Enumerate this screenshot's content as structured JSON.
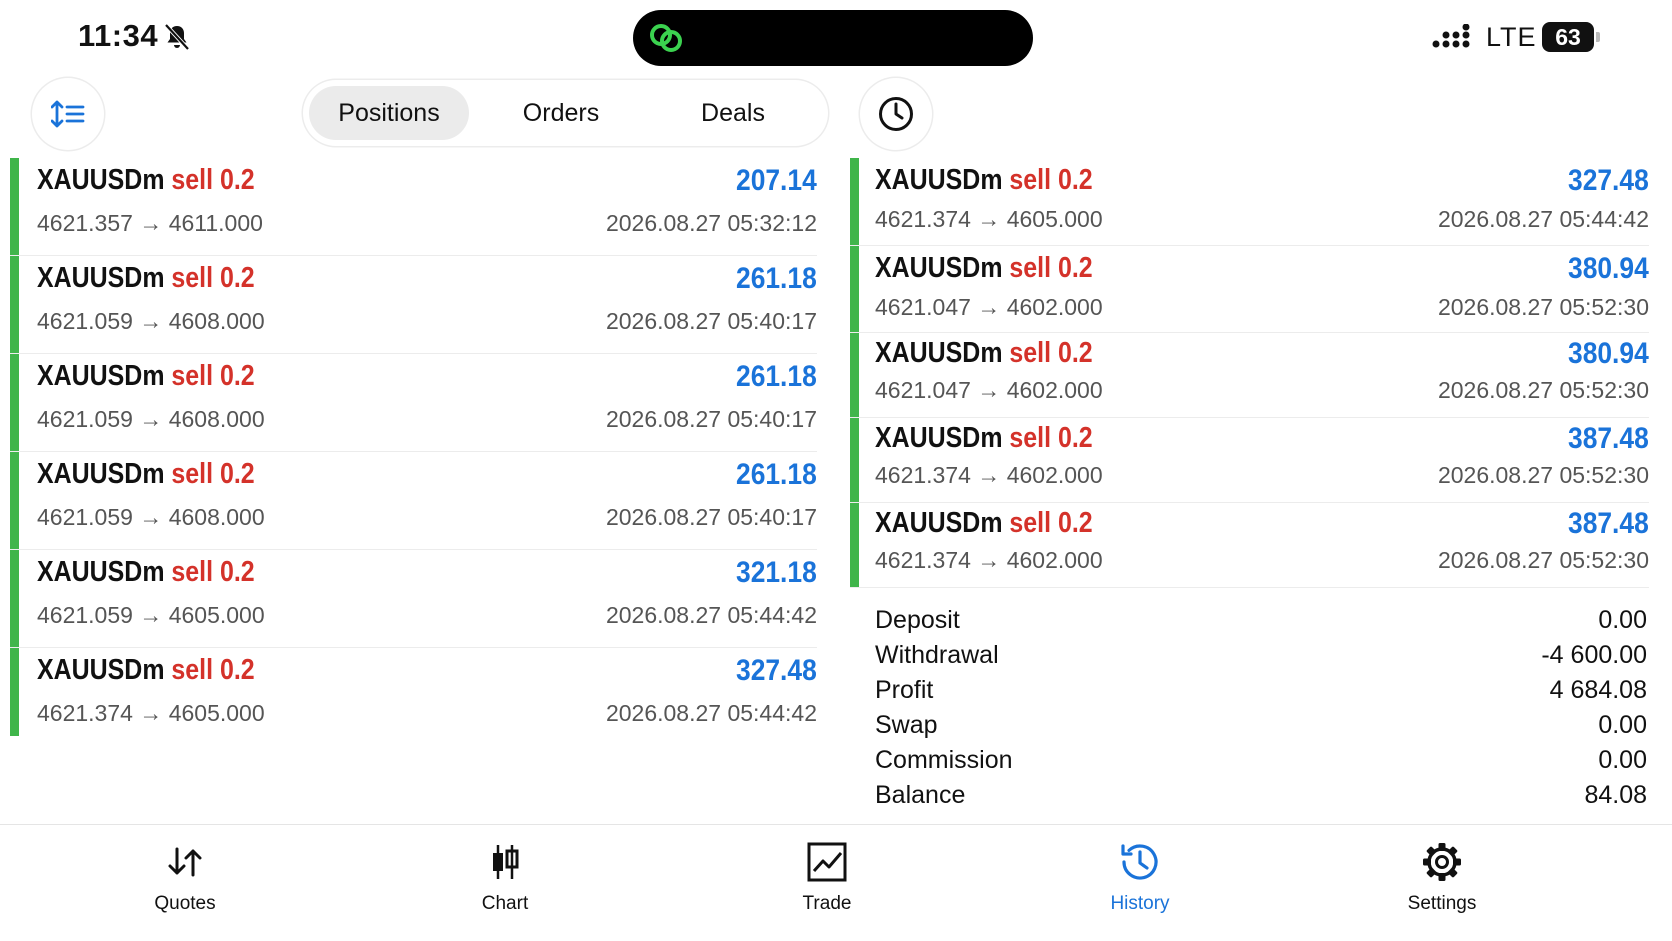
{
  "status_bar": {
    "time": "11:34",
    "network": "LTE",
    "battery": "63"
  },
  "toolbar": {
    "tabs": [
      {
        "label": "Positions",
        "active": true
      },
      {
        "label": "Orders",
        "active": false
      },
      {
        "label": "Deals",
        "active": false
      }
    ]
  },
  "deals_left": [
    {
      "symbol": "XAUUSDm",
      "side": "sell 0.2",
      "prices": "4621.357 → 4611.000",
      "profit": "207.14",
      "time": "2026.08.27 05:32:12"
    },
    {
      "symbol": "XAUUSDm",
      "side": "sell 0.2",
      "prices": "4621.059 → 4608.000",
      "profit": "261.18",
      "time": "2026.08.27 05:40:17"
    },
    {
      "symbol": "XAUUSDm",
      "side": "sell 0.2",
      "prices": "4621.059 → 4608.000",
      "profit": "261.18",
      "time": "2026.08.27 05:40:17"
    },
    {
      "symbol": "XAUUSDm",
      "side": "sell 0.2",
      "prices": "4621.059 → 4608.000",
      "profit": "261.18",
      "time": "2026.08.27 05:40:17"
    },
    {
      "symbol": "XAUUSDm",
      "side": "sell 0.2",
      "prices": "4621.059 → 4605.000",
      "profit": "321.18",
      "time": "2026.08.27 05:44:42"
    },
    {
      "symbol": "XAUUSDm",
      "side": "sell 0.2",
      "prices": "4621.374 → 4605.000",
      "profit": "327.48",
      "time": "2026.08.27 05:44:42"
    }
  ],
  "deals_right": [
    {
      "symbol": "XAUUSDm",
      "side": "sell 0.2",
      "prices": "4621.374 → 4605.000",
      "profit": "327.48",
      "time": "2026.08.27 05:44:42"
    },
    {
      "symbol": "XAUUSDm",
      "side": "sell 0.2",
      "prices": "4621.047 → 4602.000",
      "profit": "380.94",
      "time": "2026.08.27 05:52:30"
    },
    {
      "symbol": "XAUUSDm",
      "side": "sell 0.2",
      "prices": "4621.047 → 4602.000",
      "profit": "380.94",
      "time": "2026.08.27 05:52:30"
    },
    {
      "symbol": "XAUUSDm",
      "side": "sell 0.2",
      "prices": "4621.374 → 4602.000",
      "profit": "387.48",
      "time": "2026.08.27 05:52:30"
    },
    {
      "symbol": "XAUUSDm",
      "side": "sell 0.2",
      "prices": "4621.374 → 4602.000",
      "profit": "387.48",
      "time": "2026.08.27 05:52:30"
    }
  ],
  "summary": [
    {
      "label": "Deposit",
      "value": "0.00"
    },
    {
      "label": "Withdrawal",
      "value": "-4 600.00"
    },
    {
      "label": "Profit",
      "value": "4 684.08"
    },
    {
      "label": "Swap",
      "value": "0.00"
    },
    {
      "label": "Commission",
      "value": "0.00"
    },
    {
      "label": "Balance",
      "value": "84.08"
    }
  ],
  "tab_bar": [
    {
      "label": "Quotes",
      "icon": "quotes-icon",
      "active": false
    },
    {
      "label": "Chart",
      "icon": "chart-icon",
      "active": false
    },
    {
      "label": "Trade",
      "icon": "trade-icon",
      "active": false
    },
    {
      "label": "History",
      "icon": "history-icon",
      "active": true
    },
    {
      "label": "Settings",
      "icon": "settings-icon",
      "active": false
    }
  ],
  "colors": {
    "accent": "#1a73d9",
    "sell": "#d4322a",
    "profit_bar": "#3fb54a"
  }
}
